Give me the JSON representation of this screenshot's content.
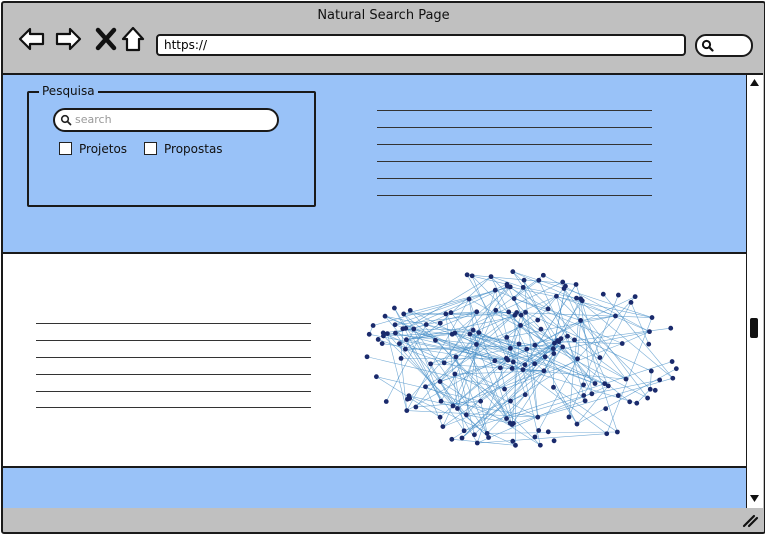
{
  "window": {
    "title": "Natural Search Page"
  },
  "address_bar": {
    "url": "https://"
  },
  "search_panel": {
    "legend": "Pesquisa",
    "search_placeholder": "search",
    "options": [
      {
        "label": "Projetos",
        "checked": false
      },
      {
        "label": "Propostas",
        "checked": false
      }
    ]
  },
  "icons": {
    "back": "back-arrow-icon",
    "forward": "forward-arrow-icon",
    "stop": "close-icon",
    "home": "home-icon",
    "search": "search-icon",
    "resize": "resize-grip-icon"
  },
  "colors": {
    "content_background": "#99c2f8",
    "chrome": "#c0c0c0",
    "network_edge": "#4a90c8",
    "network_node": "#1a2a6c"
  }
}
